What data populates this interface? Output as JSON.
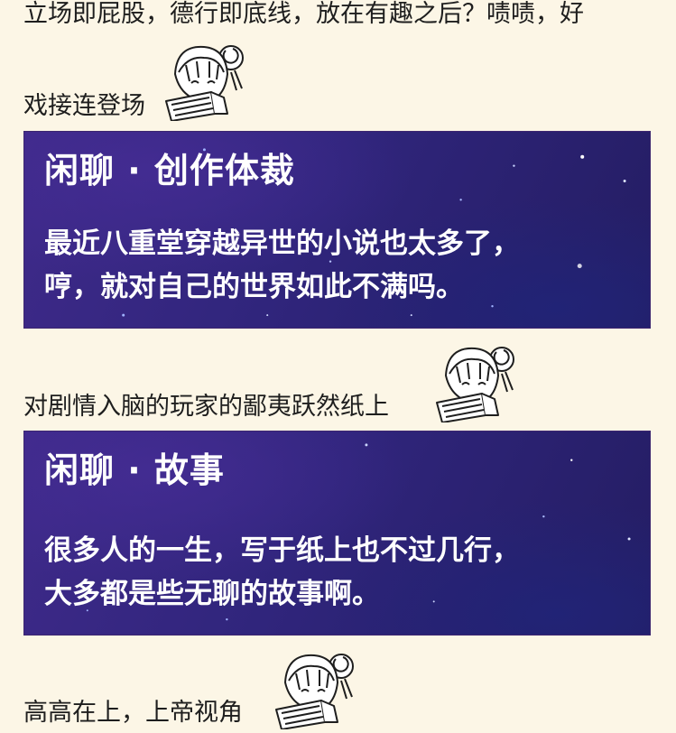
{
  "article": {
    "line1": "立场即屁股，德行即底线，放在有趣之后？啧啧，好",
    "line2": "戏接连登场",
    "line3": "对剧情入脑的玩家的鄙夷跃然纸上",
    "line4": "高高在上，上帝视角"
  },
  "cards": [
    {
      "title": "闲聊 · 创作体裁",
      "lines": [
        "最近八重堂穿越异世的小说也太多了，",
        "哼，就对自己的世界如此不满吗。"
      ]
    },
    {
      "title": "闲聊 · 故事",
      "lines": [
        "很多人的一生，写于纸上也不过几行，",
        "大多都是些无聊的故事啊。"
      ]
    }
  ],
  "sticker": {
    "icon": "anime-girl-fan-sticker-icon",
    "hair_color": "#ffffff",
    "line_color": "#1e1e1e"
  }
}
